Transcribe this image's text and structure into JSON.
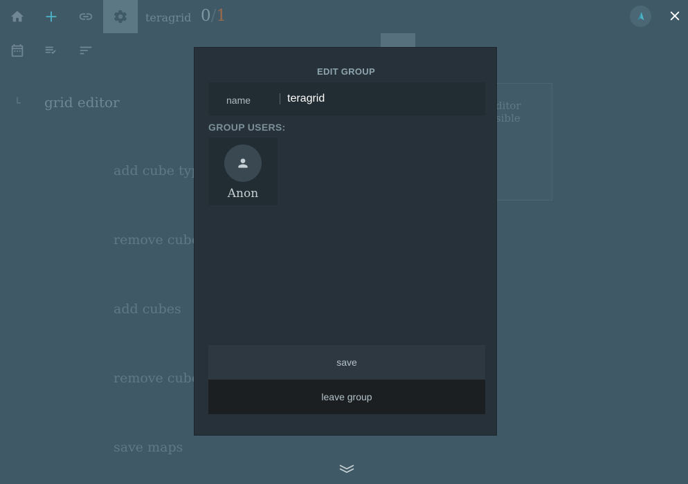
{
  "topbar": {
    "group_name": "teragrid",
    "counter_current": "0",
    "counter_separator": "/",
    "counter_total": "1",
    "icons": [
      "home-icon",
      "add-icon",
      "link-icon",
      "gear-icon",
      "logo-icon",
      "close-icon"
    ]
  },
  "toolbar2": {
    "icons": [
      "calendar-icon",
      "checklist-icon",
      "sort-icon"
    ]
  },
  "background": {
    "grid_editor_title": "grid editor",
    "actions": [
      "add cube typ",
      "remove cube",
      "add cubes",
      "remove cube",
      "save maps"
    ],
    "right_panel_lines": [
      "ditor",
      "sible"
    ]
  },
  "modal": {
    "title": "EDIT GROUP",
    "name_label": "name",
    "name_value": "teragrid",
    "users_label": "GROUP USERS:",
    "users": [
      {
        "name": "Anon",
        "icon": "person-icon"
      }
    ],
    "save_label": "save",
    "leave_label": "leave group"
  },
  "footer": {
    "icon": "double-chevron-down-icon"
  },
  "colors": {
    "background": "#3f5966",
    "modal": "#27313a",
    "accent": "#4fb3c7",
    "counter_total": "#9a6a4d"
  }
}
